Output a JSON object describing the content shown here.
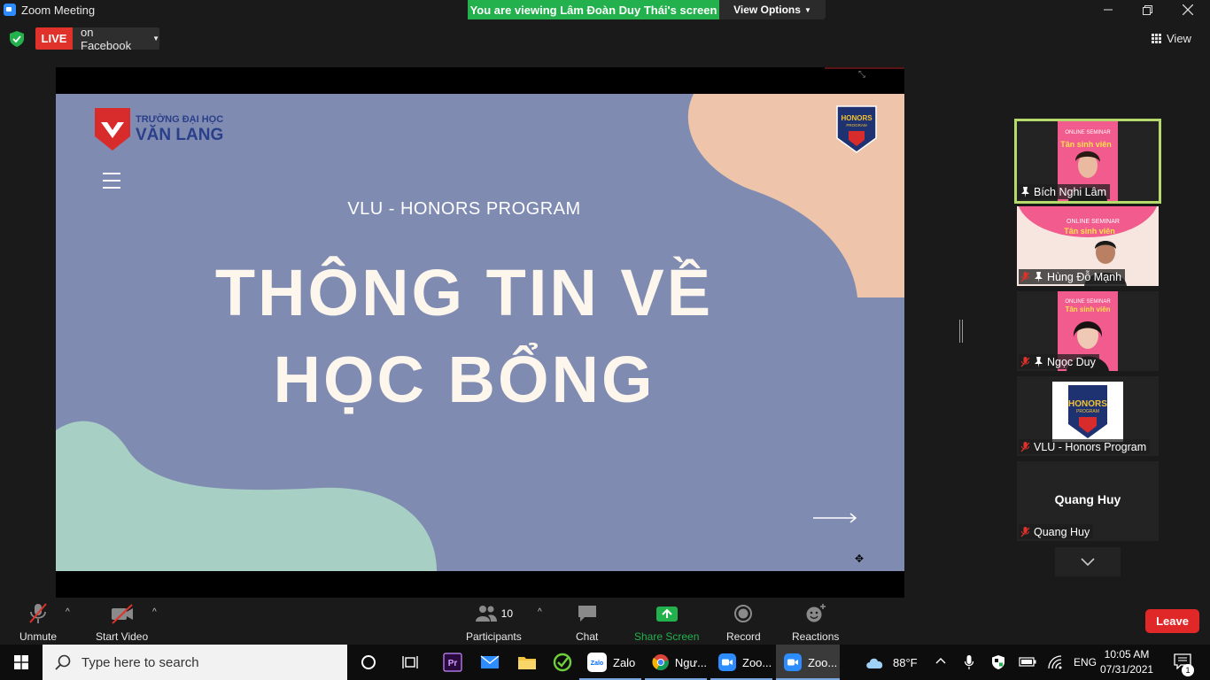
{
  "window": {
    "title": "Zoom Meeting"
  },
  "banner": {
    "viewing_text": "You are viewing Lâm Đoàn Duy Thái's screen",
    "view_options_label": "View Options"
  },
  "live": {
    "badge": "LIVE",
    "destination": "on Facebook"
  },
  "view_button": {
    "label": "View"
  },
  "slide": {
    "logo_line1": "TRƯỜNG ĐẠI HỌC",
    "logo_line2": "VĂN LANG",
    "honors_badge_line1": "HONORS",
    "honors_badge_line2": "PROGRAM",
    "subtitle": "VLU - HONORS PROGRAM",
    "title_line1": "THÔNG TIN VỀ",
    "title_line2": "HỌC BỔNG"
  },
  "gallery": [
    {
      "name": "Bích Nghi Lâm",
      "muted": false,
      "pinned": true,
      "active": true,
      "seminar_text": "ONLINE SEMINAR",
      "seminar_sub": "Tân sinh viên"
    },
    {
      "name": "Hùng Đỗ Mạnh",
      "muted": true,
      "pinned": true,
      "active": false,
      "seminar_text": "ONLINE SEMINAR",
      "seminar_sub": "Tân sinh viên"
    },
    {
      "name": "Ngọc Duy",
      "muted": true,
      "pinned": true,
      "active": false,
      "seminar_text": "ONLINE SEMINAR",
      "seminar_sub": "Tân sinh viên"
    },
    {
      "name": "VLU - Honors Program",
      "muted": true,
      "pinned": false,
      "active": false,
      "badge_line1": "HONORS",
      "badge_line2": "PROGRAM"
    },
    {
      "name": "Quang Huy",
      "muted": true,
      "pinned": false,
      "active": false,
      "display_name": "Quang Huy"
    }
  ],
  "controls": {
    "unmute": "Unmute",
    "start_video": "Start Video",
    "participants": "Participants",
    "participants_count": "10",
    "chat": "Chat",
    "share_screen": "Share Screen",
    "record": "Record",
    "reactions": "Reactions",
    "leave": "Leave"
  },
  "taskbar": {
    "search_placeholder": "Type here to search",
    "apps": [
      {
        "label": "Zalo"
      },
      {
        "label": "Ngư..."
      },
      {
        "label": "Zoo..."
      },
      {
        "label": "Zoo..."
      }
    ],
    "weather": "88°F",
    "language": "ENG",
    "time": "10:05 AM",
    "date": "07/31/2021",
    "notifications": "1"
  },
  "colors": {
    "live_red": "#e0312a",
    "share_green": "#23b14d",
    "slide_bg": "#7f8bb1",
    "active_tile": "#b5d96a",
    "leave_red": "#e02828"
  }
}
